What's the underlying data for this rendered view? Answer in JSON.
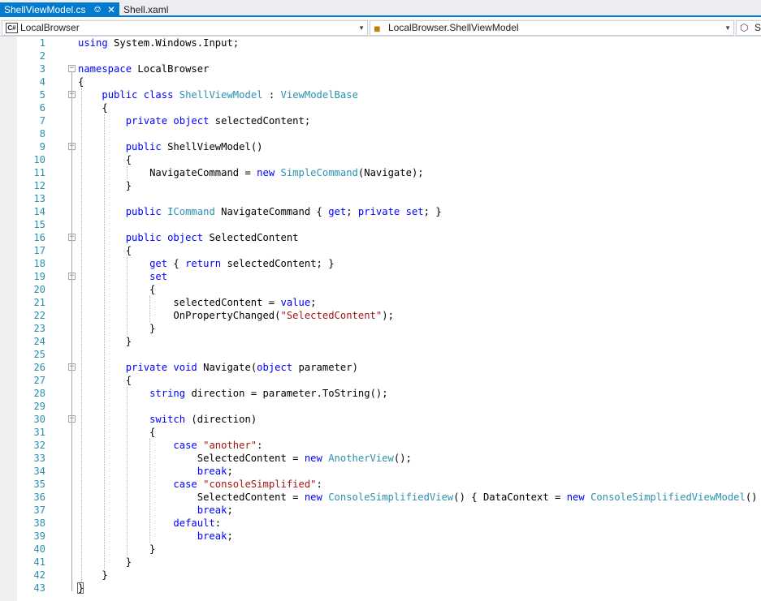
{
  "tabs": [
    {
      "label": "ShellViewModel.cs",
      "active": true
    },
    {
      "label": "Shell.xaml",
      "active": false
    }
  ],
  "tab_icons": {
    "pin": "pin-icon",
    "close": "close-icon"
  },
  "navbar": {
    "project_icon": "C#",
    "project": "LocalBrowser",
    "type": "LocalBrowser.ShellViewModel",
    "member": "Sh"
  },
  "colors": {
    "accent": "#007acc",
    "keyword": "#0000ff",
    "type": "#2b91af",
    "string": "#a31515",
    "line_number": "#2b91af"
  },
  "code": {
    "lines": [
      "using System.Windows.Input;",
      "",
      "namespace LocalBrowser",
      "{",
      "    public class ShellViewModel : ViewModelBase",
      "    {",
      "        private object selectedContent;",
      "",
      "        public ShellViewModel()",
      "        {",
      "            NavigateCommand = new SimpleCommand(Navigate);",
      "        }",
      "",
      "        public ICommand NavigateCommand { get; private set; }",
      "",
      "        public object SelectedContent",
      "        {",
      "            get { return selectedContent; }",
      "            set",
      "            {",
      "                selectedContent = value;",
      "                OnPropertyChanged(\"SelectedContent\");",
      "            }",
      "        }",
      "",
      "        private void Navigate(object parameter)",
      "        {",
      "            string direction = parameter.ToString();",
      "",
      "            switch (direction)",
      "            {",
      "                case \"another\":",
      "                    SelectedContent = new AnotherView();",
      "                    break;",
      "                case \"consoleSimplified\":",
      "                    SelectedContent = new ConsoleSimplifiedView() { DataContext = new ConsoleSimplifiedViewModel() };",
      "                    break;",
      "                default:",
      "                    break;",
      "            }",
      "        }",
      "    }",
      "}"
    ]
  }
}
